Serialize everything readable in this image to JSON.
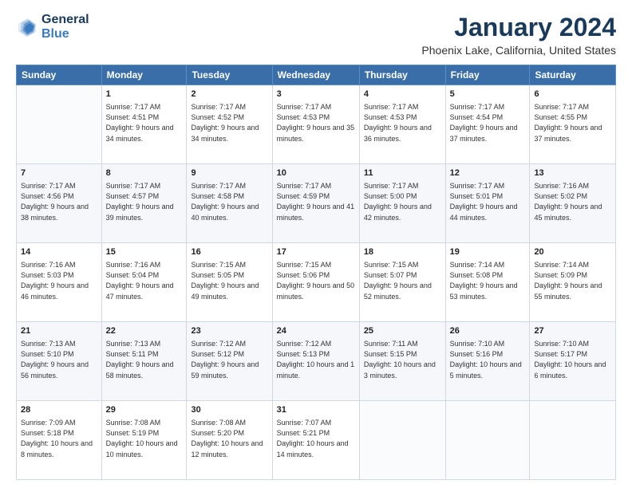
{
  "logo": {
    "line1": "General",
    "line2": "Blue"
  },
  "title": "January 2024",
  "subtitle": "Phoenix Lake, California, United States",
  "headers": [
    "Sunday",
    "Monday",
    "Tuesday",
    "Wednesday",
    "Thursday",
    "Friday",
    "Saturday"
  ],
  "weeks": [
    [
      {
        "day": "",
        "sunrise": "",
        "sunset": "",
        "daylight": ""
      },
      {
        "day": "1",
        "sunrise": "Sunrise: 7:17 AM",
        "sunset": "Sunset: 4:51 PM",
        "daylight": "Daylight: 9 hours and 34 minutes."
      },
      {
        "day": "2",
        "sunrise": "Sunrise: 7:17 AM",
        "sunset": "Sunset: 4:52 PM",
        "daylight": "Daylight: 9 hours and 34 minutes."
      },
      {
        "day": "3",
        "sunrise": "Sunrise: 7:17 AM",
        "sunset": "Sunset: 4:53 PM",
        "daylight": "Daylight: 9 hours and 35 minutes."
      },
      {
        "day": "4",
        "sunrise": "Sunrise: 7:17 AM",
        "sunset": "Sunset: 4:53 PM",
        "daylight": "Daylight: 9 hours and 36 minutes."
      },
      {
        "day": "5",
        "sunrise": "Sunrise: 7:17 AM",
        "sunset": "Sunset: 4:54 PM",
        "daylight": "Daylight: 9 hours and 37 minutes."
      },
      {
        "day": "6",
        "sunrise": "Sunrise: 7:17 AM",
        "sunset": "Sunset: 4:55 PM",
        "daylight": "Daylight: 9 hours and 37 minutes."
      }
    ],
    [
      {
        "day": "7",
        "sunrise": "Sunrise: 7:17 AM",
        "sunset": "Sunset: 4:56 PM",
        "daylight": "Daylight: 9 hours and 38 minutes."
      },
      {
        "day": "8",
        "sunrise": "Sunrise: 7:17 AM",
        "sunset": "Sunset: 4:57 PM",
        "daylight": "Daylight: 9 hours and 39 minutes."
      },
      {
        "day": "9",
        "sunrise": "Sunrise: 7:17 AM",
        "sunset": "Sunset: 4:58 PM",
        "daylight": "Daylight: 9 hours and 40 minutes."
      },
      {
        "day": "10",
        "sunrise": "Sunrise: 7:17 AM",
        "sunset": "Sunset: 4:59 PM",
        "daylight": "Daylight: 9 hours and 41 minutes."
      },
      {
        "day": "11",
        "sunrise": "Sunrise: 7:17 AM",
        "sunset": "Sunset: 5:00 PM",
        "daylight": "Daylight: 9 hours and 42 minutes."
      },
      {
        "day": "12",
        "sunrise": "Sunrise: 7:17 AM",
        "sunset": "Sunset: 5:01 PM",
        "daylight": "Daylight: 9 hours and 44 minutes."
      },
      {
        "day": "13",
        "sunrise": "Sunrise: 7:16 AM",
        "sunset": "Sunset: 5:02 PM",
        "daylight": "Daylight: 9 hours and 45 minutes."
      }
    ],
    [
      {
        "day": "14",
        "sunrise": "Sunrise: 7:16 AM",
        "sunset": "Sunset: 5:03 PM",
        "daylight": "Daylight: 9 hours and 46 minutes."
      },
      {
        "day": "15",
        "sunrise": "Sunrise: 7:16 AM",
        "sunset": "Sunset: 5:04 PM",
        "daylight": "Daylight: 9 hours and 47 minutes."
      },
      {
        "day": "16",
        "sunrise": "Sunrise: 7:15 AM",
        "sunset": "Sunset: 5:05 PM",
        "daylight": "Daylight: 9 hours and 49 minutes."
      },
      {
        "day": "17",
        "sunrise": "Sunrise: 7:15 AM",
        "sunset": "Sunset: 5:06 PM",
        "daylight": "Daylight: 9 hours and 50 minutes."
      },
      {
        "day": "18",
        "sunrise": "Sunrise: 7:15 AM",
        "sunset": "Sunset: 5:07 PM",
        "daylight": "Daylight: 9 hours and 52 minutes."
      },
      {
        "day": "19",
        "sunrise": "Sunrise: 7:14 AM",
        "sunset": "Sunset: 5:08 PM",
        "daylight": "Daylight: 9 hours and 53 minutes."
      },
      {
        "day": "20",
        "sunrise": "Sunrise: 7:14 AM",
        "sunset": "Sunset: 5:09 PM",
        "daylight": "Daylight: 9 hours and 55 minutes."
      }
    ],
    [
      {
        "day": "21",
        "sunrise": "Sunrise: 7:13 AM",
        "sunset": "Sunset: 5:10 PM",
        "daylight": "Daylight: 9 hours and 56 minutes."
      },
      {
        "day": "22",
        "sunrise": "Sunrise: 7:13 AM",
        "sunset": "Sunset: 5:11 PM",
        "daylight": "Daylight: 9 hours and 58 minutes."
      },
      {
        "day": "23",
        "sunrise": "Sunrise: 7:12 AM",
        "sunset": "Sunset: 5:12 PM",
        "daylight": "Daylight: 9 hours and 59 minutes."
      },
      {
        "day": "24",
        "sunrise": "Sunrise: 7:12 AM",
        "sunset": "Sunset: 5:13 PM",
        "daylight": "Daylight: 10 hours and 1 minute."
      },
      {
        "day": "25",
        "sunrise": "Sunrise: 7:11 AM",
        "sunset": "Sunset: 5:15 PM",
        "daylight": "Daylight: 10 hours and 3 minutes."
      },
      {
        "day": "26",
        "sunrise": "Sunrise: 7:10 AM",
        "sunset": "Sunset: 5:16 PM",
        "daylight": "Daylight: 10 hours and 5 minutes."
      },
      {
        "day": "27",
        "sunrise": "Sunrise: 7:10 AM",
        "sunset": "Sunset: 5:17 PM",
        "daylight": "Daylight: 10 hours and 6 minutes."
      }
    ],
    [
      {
        "day": "28",
        "sunrise": "Sunrise: 7:09 AM",
        "sunset": "Sunset: 5:18 PM",
        "daylight": "Daylight: 10 hours and 8 minutes."
      },
      {
        "day": "29",
        "sunrise": "Sunrise: 7:08 AM",
        "sunset": "Sunset: 5:19 PM",
        "daylight": "Daylight: 10 hours and 10 minutes."
      },
      {
        "day": "30",
        "sunrise": "Sunrise: 7:08 AM",
        "sunset": "Sunset: 5:20 PM",
        "daylight": "Daylight: 10 hours and 12 minutes."
      },
      {
        "day": "31",
        "sunrise": "Sunrise: 7:07 AM",
        "sunset": "Sunset: 5:21 PM",
        "daylight": "Daylight: 10 hours and 14 minutes."
      },
      {
        "day": "",
        "sunrise": "",
        "sunset": "",
        "daylight": ""
      },
      {
        "day": "",
        "sunrise": "",
        "sunset": "",
        "daylight": ""
      },
      {
        "day": "",
        "sunrise": "",
        "sunset": "",
        "daylight": ""
      }
    ]
  ]
}
